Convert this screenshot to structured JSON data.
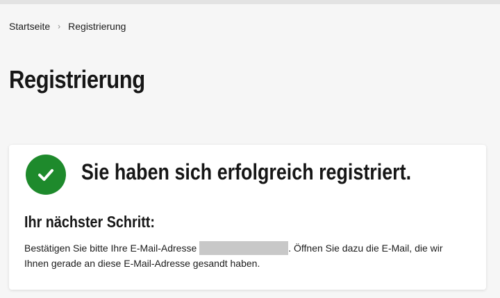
{
  "breadcrumb": {
    "home": "Startseite",
    "separator": "›",
    "current": "Registrierung"
  },
  "page": {
    "title": "Registrierung"
  },
  "card": {
    "icon": "check-circle-icon",
    "success_color": "#1e8a2c",
    "success_message": "Sie haben sich erfolgreich registriert.",
    "next_step_heading": "Ihr nächster Schritt:",
    "instructions_before": "Bestätigen Sie bitte Ihre E-Mail-Adresse",
    "instructions_after": ". Öffnen Sie dazu die E-Mail, die wir Ihnen gerade an diese E-Mail-Adresse gesandt haben."
  }
}
